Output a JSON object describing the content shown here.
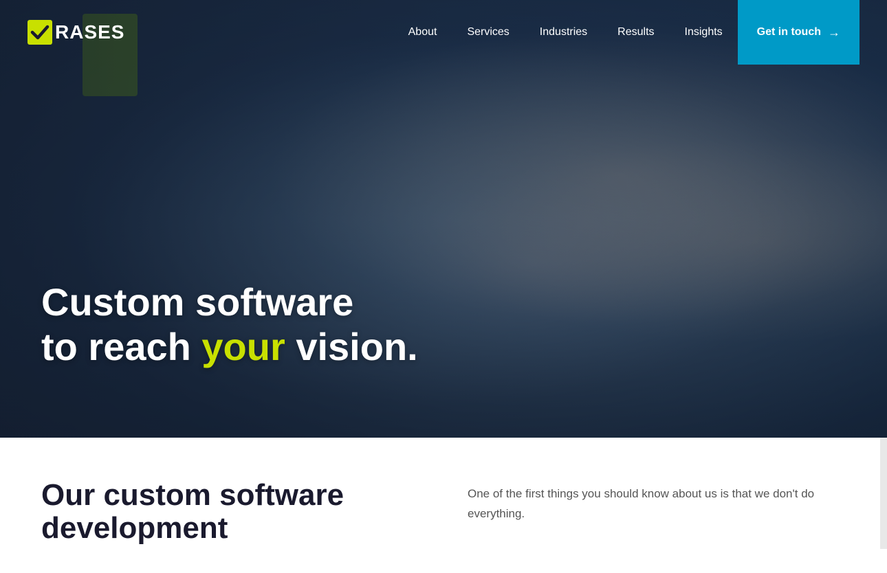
{
  "brand": {
    "logo_text": "RASES",
    "logo_icon": "checkbox-icon"
  },
  "nav": {
    "items": [
      {
        "label": "About",
        "id": "about",
        "active": false
      },
      {
        "label": "Services",
        "id": "services",
        "active": false
      },
      {
        "label": "Industries",
        "id": "industries",
        "active": false
      },
      {
        "label": "Results",
        "id": "results",
        "active": false
      },
      {
        "label": "Insights",
        "id": "insights",
        "active": false
      }
    ],
    "cta_label": "Get in touch",
    "cta_arrow": "→"
  },
  "hero": {
    "line1": "Custom software",
    "line2_before": "to reach ",
    "line2_highlight": "your",
    "line2_after": " vision.",
    "highlight_color": "#c8e000"
  },
  "below_hero": {
    "title_line1": "Our custom software",
    "title_line2": "development",
    "body_text": "One of the first things you should know about us is that we don't do everything."
  }
}
